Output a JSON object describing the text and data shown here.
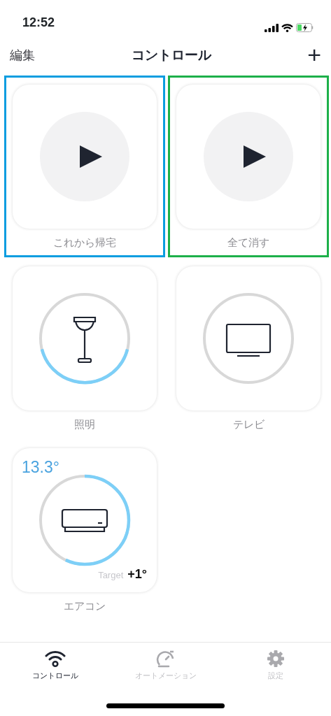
{
  "status_bar": {
    "time": "12:52"
  },
  "nav": {
    "edit": "編集",
    "title": "コントロール",
    "add": "+"
  },
  "tiles": [
    {
      "kind": "scene",
      "label": "これから帰宅",
      "color": "#0a9de0"
    },
    {
      "kind": "scene",
      "label": "全て消す",
      "color": "#1db04a"
    },
    {
      "kind": "light",
      "label": "照明",
      "level": 0.42
    },
    {
      "kind": "tv",
      "label": "テレビ"
    },
    {
      "kind": "aircon",
      "label": "エアコン",
      "level": 0.57,
      "temperature": "13.3°",
      "target_label": "Target",
      "target": "+1°"
    }
  ],
  "tab_bar": [
    {
      "kind": "control",
      "label": "コントロール",
      "selected": true
    },
    {
      "kind": "automation",
      "label": "オートメーション",
      "selected": false
    },
    {
      "kind": "settings",
      "label": "設定",
      "selected": false
    }
  ]
}
